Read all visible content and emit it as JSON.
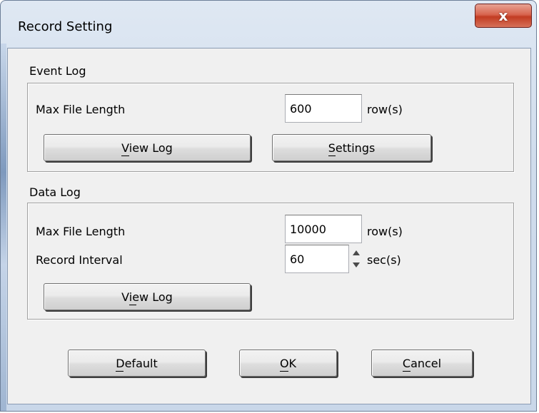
{
  "window": {
    "title": "Record Setting",
    "close_glyph": "x"
  },
  "event_log": {
    "group_label": "Event Log",
    "max_file_length_label": "Max File Length",
    "max_file_length_value": "600",
    "max_file_length_unit": "row(s)",
    "view_log_button": "View Log",
    "settings_button": "Settings"
  },
  "data_log": {
    "group_label": "Data Log",
    "max_file_length_label": "Max File Length",
    "max_file_length_value": "10000",
    "max_file_length_unit": "row(s)",
    "record_interval_label": "Record Interval",
    "record_interval_value": "60",
    "record_interval_unit": "sec(s)",
    "view_log_button": "View Log"
  },
  "footer": {
    "default_button": "Default",
    "ok_button": "OK",
    "cancel_button": "Cancel"
  },
  "colors": {
    "close_button": "#c94a31",
    "dialog_background": "#f0f0f0",
    "frame": "#cfdcec"
  }
}
